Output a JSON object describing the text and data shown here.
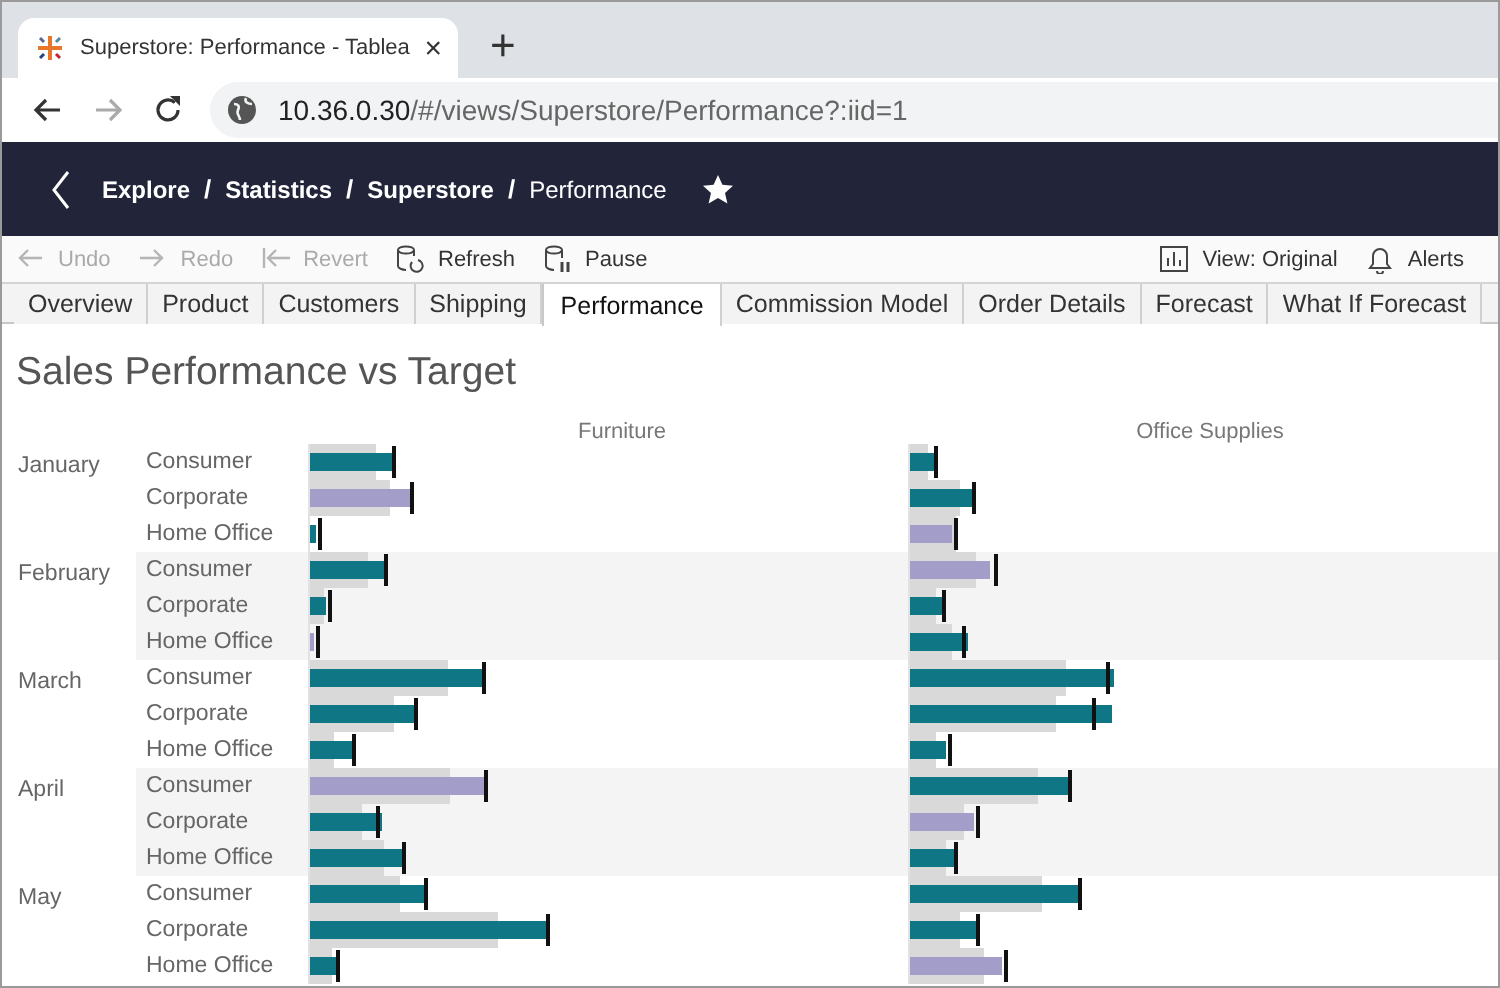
{
  "browser": {
    "tab_title": "Superstore: Performance - Tablea",
    "close": "×",
    "new_tab": "+",
    "url_host": "10.36.0.30",
    "url_path": "/#/views/Superstore/Performance?:iid=1"
  },
  "breadcrumb": [
    {
      "label": "Explore",
      "current": false
    },
    {
      "label": "Statistics",
      "current": false
    },
    {
      "label": "Superstore",
      "current": false
    },
    {
      "label": "Performance",
      "current": true
    }
  ],
  "breadcrumb_separator": "/",
  "toolbar": {
    "left": [
      {
        "kind": "undo",
        "label": "Undo",
        "disabled": true
      },
      {
        "kind": "redo",
        "label": "Redo",
        "disabled": true
      },
      {
        "kind": "revert",
        "label": "Revert",
        "disabled": true
      },
      {
        "kind": "refresh",
        "label": "Refresh",
        "disabled": false
      },
      {
        "kind": "pause",
        "label": "Pause",
        "disabled": false
      }
    ],
    "right": [
      {
        "kind": "view",
        "label": "View: Original",
        "disabled": false
      },
      {
        "kind": "alerts",
        "label": "Alerts",
        "disabled": false
      }
    ]
  },
  "tabs": [
    {
      "label": "Overview",
      "selected": false
    },
    {
      "label": "Product",
      "selected": false
    },
    {
      "label": "Customers",
      "selected": false
    },
    {
      "label": "Shipping",
      "selected": false
    },
    {
      "label": "Performance",
      "selected": true
    },
    {
      "label": "Commission Model",
      "selected": false
    },
    {
      "label": "Order Details",
      "selected": false
    },
    {
      "label": "Forecast",
      "selected": false
    },
    {
      "label": "What If Forecast",
      "selected": false
    }
  ],
  "view": {
    "title": "Sales Performance vs Target",
    "columns": [
      "Furniture",
      "Office Supplies"
    ],
    "months": [
      {
        "month": "January",
        "segments": [
          {
            "segment": "Consumer",
            "bars": [
              {
                "color": "#0f7685"
              },
              {
                "color": "#0f7685"
              }
            ]
          },
          {
            "segment": "Corporate",
            "bars": [
              {
                "color": "#a39dc9"
              },
              {
                "color": "#0f7685"
              }
            ]
          },
          {
            "segment": "Home Office",
            "bars": [
              {
                "color": "#0f7685"
              },
              {
                "color": "#a39dc9"
              }
            ]
          }
        ]
      },
      {
        "month": "February",
        "segments": [
          {
            "segment": "Consumer",
            "bars": [
              {
                "color": "#0f7685"
              },
              {
                "color": "#a39dc9"
              }
            ]
          },
          {
            "segment": "Corporate",
            "bars": [
              {
                "color": "#0f7685"
              },
              {
                "color": "#0f7685"
              }
            ]
          },
          {
            "segment": "Home Office",
            "bars": [
              {
                "color": "#a39dc9"
              },
              {
                "color": "#0f7685"
              }
            ]
          }
        ]
      },
      {
        "month": "March",
        "segments": [
          {
            "segment": "Consumer",
            "bars": [
              {
                "color": "#0f7685"
              },
              {
                "color": "#0f7685"
              }
            ]
          },
          {
            "segment": "Corporate",
            "bars": [
              {
                "color": "#0f7685"
              },
              {
                "color": "#0f7685"
              }
            ]
          },
          {
            "segment": "Home Office",
            "bars": [
              {
                "color": "#0f7685"
              },
              {
                "color": "#0f7685"
              }
            ]
          }
        ]
      },
      {
        "month": "April",
        "segments": [
          {
            "segment": "Consumer",
            "bars": [
              {
                "color": "#a39dc9"
              },
              {
                "color": "#0f7685"
              }
            ]
          },
          {
            "segment": "Corporate",
            "bars": [
              {
                "color": "#0f7685"
              },
              {
                "color": "#a39dc9"
              }
            ]
          },
          {
            "segment": "Home Office",
            "bars": [
              {
                "color": "#0f7685"
              },
              {
                "color": "#0f7685"
              }
            ]
          }
        ]
      },
      {
        "month": "May",
        "segments": [
          {
            "segment": "Consumer",
            "bars": [
              {
                "color": "#0f7685"
              },
              {
                "color": "#0f7685"
              }
            ]
          },
          {
            "segment": "Corporate",
            "bars": [
              {
                "color": "#0f7685"
              },
              {
                "color": "#0f7685"
              }
            ]
          },
          {
            "segment": "Home Office",
            "bars": [
              {
                "color": "#0f7685"
              },
              {
                "color": "#a39dc9"
              }
            ]
          }
        ]
      }
    ]
  }
}
